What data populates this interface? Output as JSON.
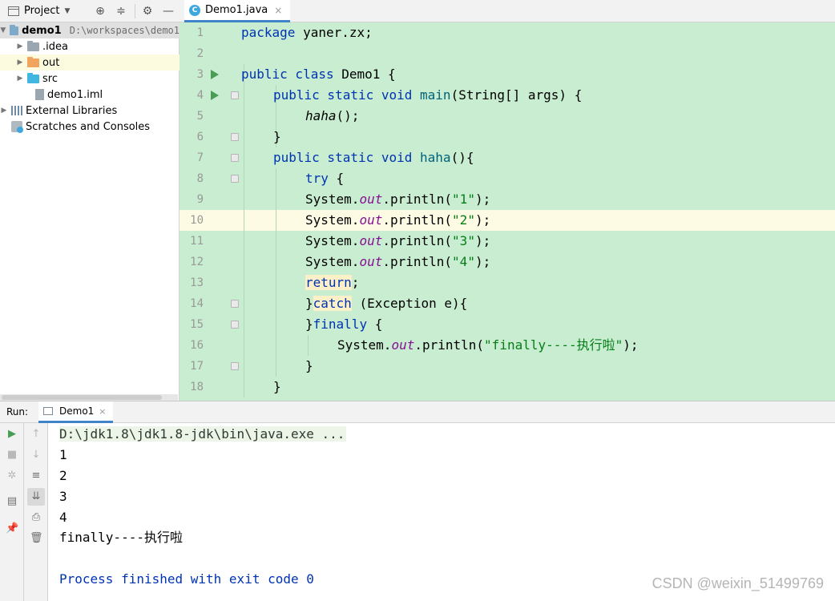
{
  "project_panel": {
    "title": "Project",
    "tree": [
      {
        "label": "demo1",
        "path": "D:\\workspaces\\demo1"
      },
      {
        "label": ".idea"
      },
      {
        "label": "out"
      },
      {
        "label": "src"
      },
      {
        "label": "demo1.iml"
      },
      {
        "label": "External Libraries"
      },
      {
        "label": "Scratches and Consoles"
      }
    ]
  },
  "editor": {
    "tab_label": "Demo1.java",
    "line_numbers": [
      "1",
      "2",
      "3",
      "4",
      "5",
      "6",
      "7",
      "8",
      "9",
      "10",
      "11",
      "12",
      "13",
      "14",
      "15",
      "16",
      "17",
      "18"
    ],
    "lines": {
      "l1_kw": "package",
      "l1_rest": " yaner.zx;",
      "l3_kw": "public class",
      "l3_rest": " Demo1 {",
      "l4_kw": "public static void",
      "l4_fn": "main",
      "l4_rest": "(String[] args) {",
      "l5_fn": "haha",
      "l5_rest": "();",
      "l6_text": "}",
      "l7_kw": "public static void",
      "l7_fn": "haha",
      "l7_rest": "(){",
      "l8_kw": "try",
      "l8_rest": " {",
      "sys": "System.",
      "out": "out",
      "println": ".println(",
      "s1": "\"1\"",
      "s2": "\"2\"",
      "s3": "\"3\"",
      "s4": "\"4\"",
      "close_paren": ");",
      "l13_kw": "return",
      "l13_rest": ";",
      "l14_pre": "}",
      "l14_kw": "catch",
      "l14_rest": " (Exception e){",
      "l15_pre": "}",
      "l15_kw": "finally",
      "l15_rest": " {",
      "s16": "\"finally----执行啦\"",
      "l17_text": "}",
      "l18_text": "}"
    }
  },
  "run_panel": {
    "label": "Run:",
    "tab_label": "Demo1",
    "console": [
      "D:\\jdk1.8\\jdk1.8-jdk\\bin\\java.exe ...",
      "1",
      "2",
      "3",
      "4",
      "finally----执行啦",
      "",
      "Process finished with exit code 0"
    ]
  },
  "watermark": "CSDN @weixin_51499769",
  "colors": {
    "editor_bg": "#c8edd0",
    "keyword": "#0033b3",
    "string": "#067d17",
    "field": "#871094",
    "run_green": "#499c54"
  },
  "icons": [
    "project-view-icon",
    "locate-icon",
    "collapse-icon",
    "gear-icon",
    "minimize-icon",
    "java-class-icon",
    "run-gutter-icon",
    "rerun-icon",
    "stop-icon",
    "up-icon",
    "down-icon",
    "soft-wrap-icon",
    "scroll-to-end-icon",
    "print-icon",
    "trash-icon",
    "pin-icon",
    "layout-icon",
    "debug-icon"
  ]
}
